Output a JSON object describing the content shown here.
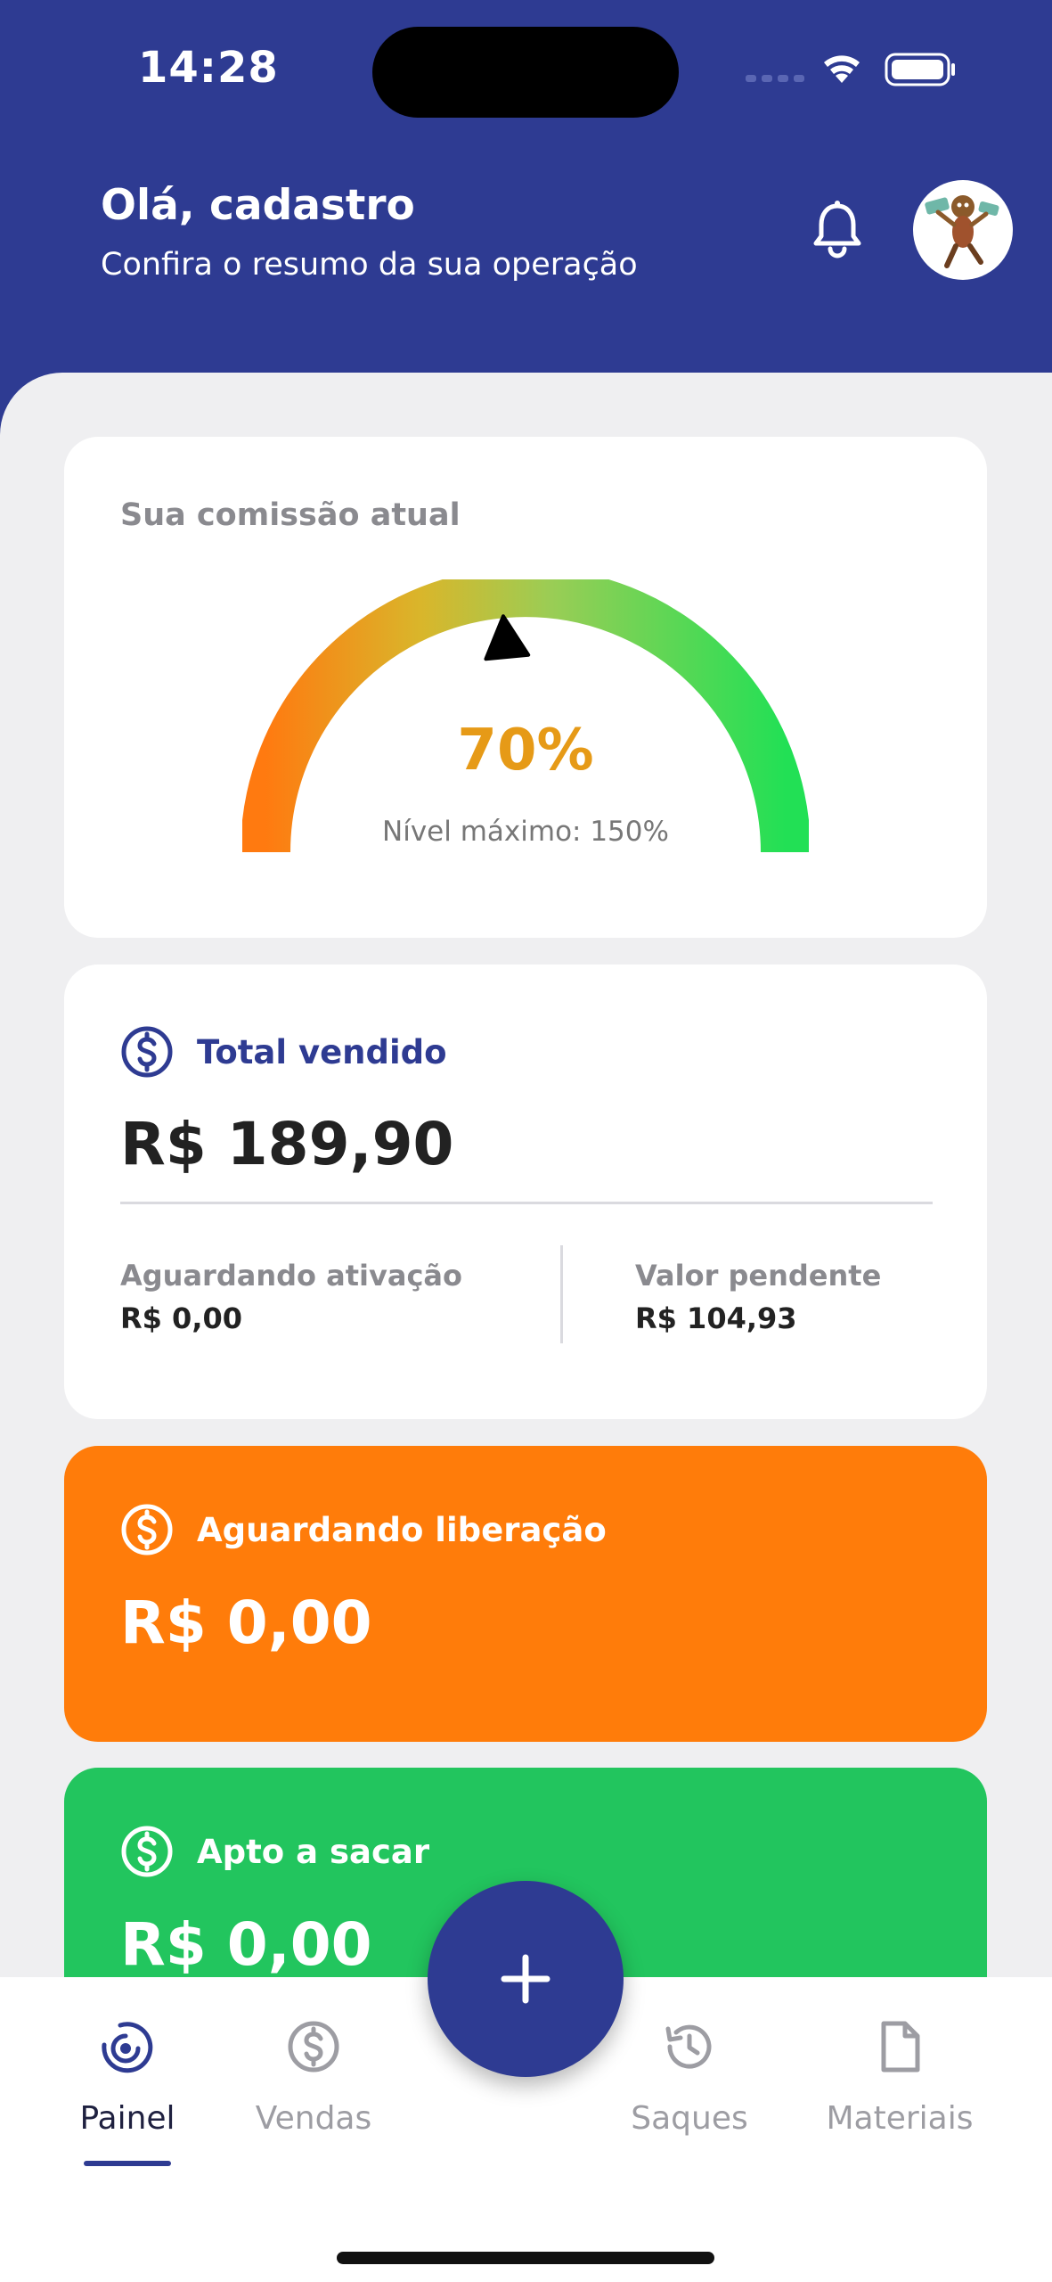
{
  "status_bar": {
    "time": "14:28"
  },
  "header": {
    "greeting": "Olá, cadastro",
    "subtitle": "Confira o resumo da sua operação"
  },
  "commission": {
    "title": "Sua comissão atual",
    "value": "70%",
    "max_label": "Nível máximo: 150%",
    "level_fraction": 0.47
  },
  "total_sold": {
    "title": "Total vendido",
    "amount": "R$ 189,90",
    "awaiting_activation_label": "Aguardando ativação",
    "awaiting_activation_value": "R$ 0,00",
    "pending_label": "Valor pendente",
    "pending_value": "R$ 104,93"
  },
  "awaiting_release": {
    "title": "Aguardando liberação",
    "amount": "R$ 0,00"
  },
  "ready_to_withdraw": {
    "title": "Apto a sacar",
    "amount": "R$ 0,00"
  },
  "tabs": [
    {
      "label": "Painel",
      "icon": "painel-icon",
      "active": true
    },
    {
      "label": "Vendas",
      "icon": "dollar-circle-icon",
      "active": false
    },
    {
      "label": "Saques",
      "icon": "history-icon",
      "active": false
    },
    {
      "label": "Materiais",
      "icon": "document-icon",
      "active": false
    }
  ],
  "colors": {
    "primary": "#2E3B92",
    "orange": "#FF7C0A",
    "green": "#22C55E",
    "gauge_value": "#E69A17"
  }
}
